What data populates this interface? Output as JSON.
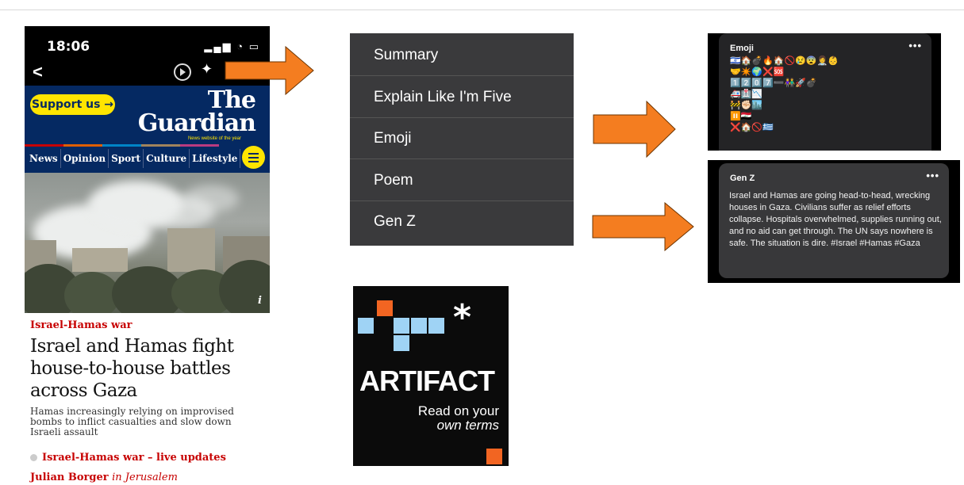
{
  "phone": {
    "status_time": "18:06",
    "support_button": "Support us →",
    "logo_line1": "The",
    "logo_line2": "Guardian",
    "logo_tagline": "News website of the year",
    "nav": [
      "News",
      "Opinion",
      "Sport",
      "Culture",
      "Lifestyle"
    ],
    "photo_info": "i",
    "kicker": "Israel-Hamas war",
    "headline": "Israel and Hamas fight house-to-house battles across Gaza",
    "standfirst": "Hamas increasingly relying on improvised bombs to inflict casualties and slow down Israeli assault",
    "live_link": "Israel-Hamas war – live updates",
    "byline_name": "Julian Borger",
    "byline_place": "in Jerusalem"
  },
  "menu": {
    "items": [
      "Summary",
      "Explain Like I'm Five",
      "Emoji",
      "Poem",
      "Gen Z"
    ]
  },
  "emoji_card": {
    "title": "Emoji",
    "dots": "•••",
    "rows": [
      "🇮🇱🏠💣🔥🏠🚫😢😨👩‍⚕️👶",
      "🤝✴️🌍❌🆘",
      "1️⃣2️⃣0️⃣7️⃣➖👫🚀💣",
      "🚑🏥📉",
      "🚧✊🏻🏙️",
      "⏸️🇮🇶",
      "❌🏠🚫🇬🇷"
    ]
  },
  "genz_card": {
    "title": "Gen Z",
    "dots": "•••",
    "text": "Israel and Hamas are going head-to-head, wrecking houses in Gaza. Civilians suffer as relief efforts collapse. Hospitals overwhelmed, supplies running out, and no aid can get through. The UN says nowhere is safe. The situation is dire.  #Israel #Hamas #Gaza"
  },
  "artifact": {
    "wordmark": "ARTIFACT",
    "tag_line1": "Read on your",
    "tag_line2": "own terms",
    "star": "*"
  },
  "colors": {
    "guardian_blue": "#052962",
    "guardian_yellow": "#ffe500",
    "guardian_red": "#c70000",
    "arrow_orange": "#f47d20",
    "artifact_orange": "#f26522",
    "artifact_blue": "#9fd3f5"
  }
}
